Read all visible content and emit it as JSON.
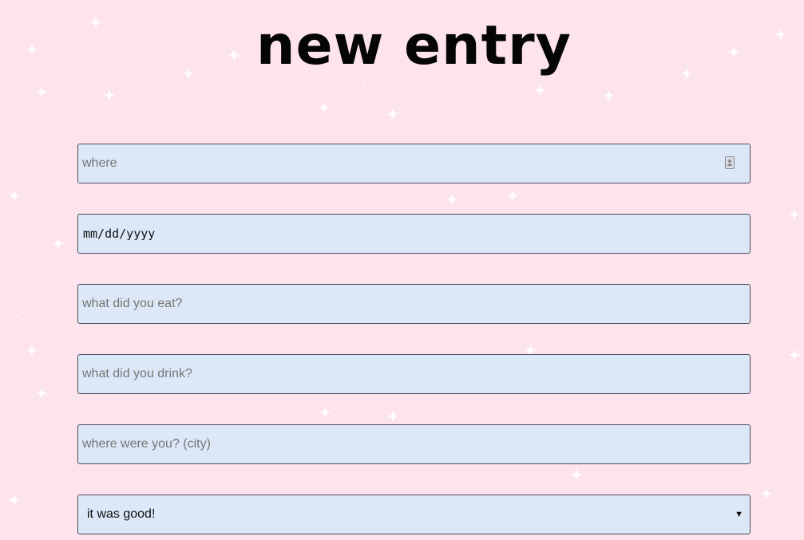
{
  "page": {
    "title": "new entry"
  },
  "form": {
    "where": {
      "placeholder": "where"
    },
    "date": {
      "placeholder": "mm/dd/yyyy"
    },
    "food": {
      "placeholder": "what did you eat?"
    },
    "drink": {
      "placeholder": "what did you drink?"
    },
    "city": {
      "placeholder": "where were you? (city)"
    },
    "rating": {
      "selected": "it was good!"
    }
  },
  "colors": {
    "background": "#fde3ec",
    "field_background": "#dce8f7",
    "field_border": "#4a4a5a",
    "sparkle": "#ffffff"
  },
  "icons": {
    "where_field": "contact-card-icon",
    "select": "dropdown-arrow-icon"
  }
}
